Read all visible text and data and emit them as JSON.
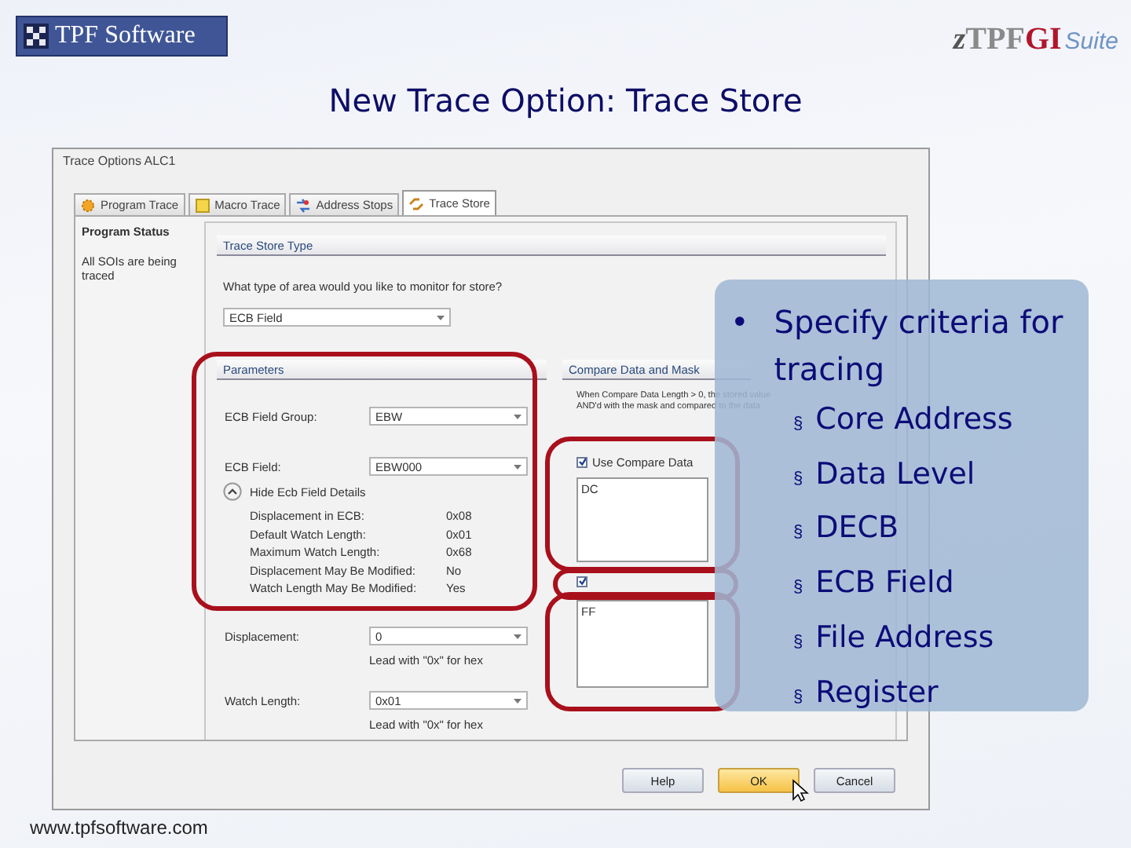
{
  "header": {
    "company_logo": "TPF Software",
    "suite_logo": {
      "prefix": "z",
      "tpf": "TPF",
      "gi": "GI",
      "suite": "Suite"
    }
  },
  "slide_title": "New Trace Option: Trace Store",
  "dialog": {
    "title": "Trace Options  ALC1",
    "tabs": [
      {
        "label": "Program Trace",
        "selected": false
      },
      {
        "label": "Macro Trace",
        "selected": false
      },
      {
        "label": "Address Stops",
        "selected": false
      },
      {
        "label": "Trace Store",
        "selected": true
      }
    ],
    "status": {
      "heading": "Program Status",
      "text": "All SOIs are being traced"
    },
    "store_type": {
      "heading": "Trace Store Type",
      "question": "What type of area would you like to monitor for store?",
      "value": "ECB Field"
    },
    "parameters": {
      "heading": "Parameters",
      "fields": [
        {
          "label": "ECB Field Group:",
          "value": "EBW"
        },
        {
          "label": "ECB Field:",
          "value": "EBW000"
        }
      ],
      "details_toggle": "Hide Ecb Field Details",
      "details": [
        {
          "label": "Displacement in ECB:",
          "value": "0x08"
        },
        {
          "label": "Default Watch Length:",
          "value": "0x01"
        },
        {
          "label": "Maximum Watch Length:",
          "value": "0x68"
        },
        {
          "label": "Displacement May Be Modified:",
          "value": "No"
        },
        {
          "label": "Watch Length May Be Modified:",
          "value": "Yes"
        }
      ],
      "inputs": [
        {
          "label": "Displacement:",
          "value": "0",
          "hint": "Lead with \"0x\" for hex"
        },
        {
          "label": "Watch Length:",
          "value": "0x01",
          "hint": "Lead with \"0x\" for hex"
        }
      ]
    },
    "compare": {
      "heading": "Compare Data and Mask",
      "note": [
        "When Compare Data Length > 0, the stored value",
        "AND'd with the mask and compared to the data"
      ],
      "use_compare": {
        "label": "Use Compare Data",
        "checked": true
      },
      "data": "DC",
      "use_mask": {
        "checked": true
      },
      "mask": "FF"
    },
    "buttons": [
      {
        "label": "Help",
        "kind": "default"
      },
      {
        "label": "OK",
        "kind": "primary"
      },
      {
        "label": "Cancel",
        "kind": "default"
      }
    ]
  },
  "callout": {
    "marker": "•",
    "heading": "Specify criteria for tracing",
    "item_marker": "§",
    "items": [
      "Core Address",
      "Data Level",
      "DECB",
      "ECB Field",
      "File Address",
      "Register"
    ]
  },
  "footer": "www.tpfsoftware.com"
}
